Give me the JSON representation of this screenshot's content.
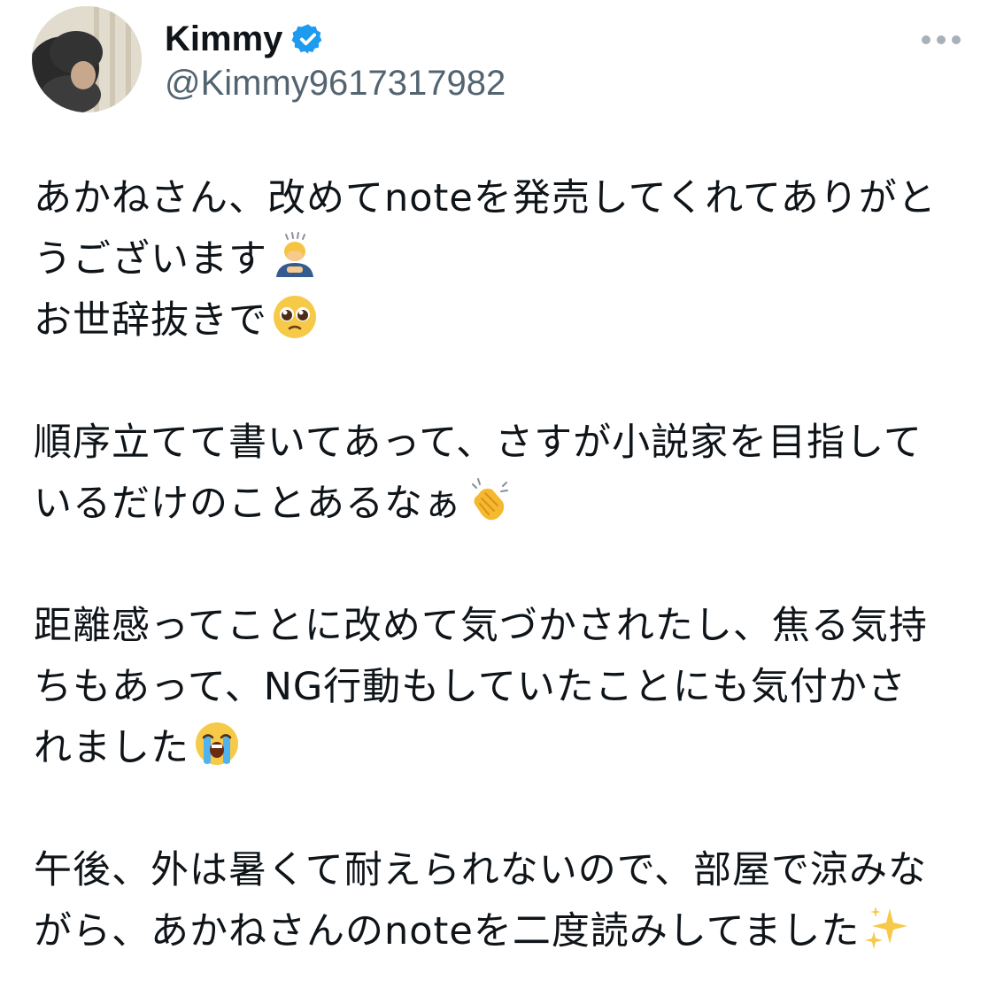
{
  "author": {
    "display_name": "Kimmy",
    "handle": "@Kimmy9617317982",
    "verified": true,
    "badge_color": "#1d9bf0"
  },
  "more_icon": "more-horizontal-icon",
  "tweet": {
    "paragraphs": [
      [
        {
          "text": "あかねさん、改めてnoteを発売してくれてありがと",
          "emoji": null
        },
        {
          "text": "うございます",
          "emoji": "person-bowing-emoji"
        },
        {
          "text": "お世辞抜きで",
          "emoji": "pleading-face-emoji"
        }
      ],
      [
        {
          "text": "順序立てて書いてあって、さすが小説家を目指して",
          "emoji": null
        },
        {
          "text": "いるだけのことあるなぁ",
          "emoji": "clapping-hands-emoji"
        }
      ],
      [
        {
          "text": "距離感ってことに改めて気づかされたし、焦る気持",
          "emoji": null
        },
        {
          "text": "ちもあって、NG行動もしていたことにも気付かさ",
          "emoji": null
        },
        {
          "text": "れました",
          "emoji": "loudly-crying-face-emoji"
        }
      ],
      [
        {
          "text": "午後、外は暑くて耐えられないので、部屋で涼みな",
          "emoji": null
        },
        {
          "text": "がら、あかねさんのnoteを二度読みしてました",
          "emoji": "sparkles-emoji"
        }
      ]
    ]
  }
}
